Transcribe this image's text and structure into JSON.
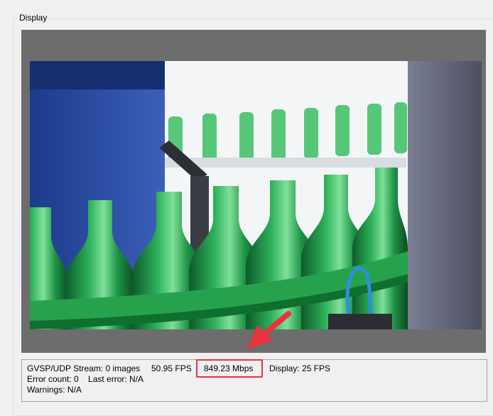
{
  "group": {
    "title": "Display"
  },
  "display": {
    "image_description_icon": "camera-image",
    "colors": {
      "panel": "#6d6d6d",
      "bottle": "#1f8f45",
      "highlight": "#e8343a"
    }
  },
  "status": {
    "stream": "GVSP/UDP Stream: 0 images",
    "fps": "50.95 FPS",
    "bandwidth": "849.23 Mbps",
    "display_fps": "Display: 25 FPS",
    "errors": "Error count: 0    Last error: N/A",
    "warnings": "Warnings: N/A"
  },
  "annotation": {
    "arrow_icon": "red-arrow-icon"
  }
}
